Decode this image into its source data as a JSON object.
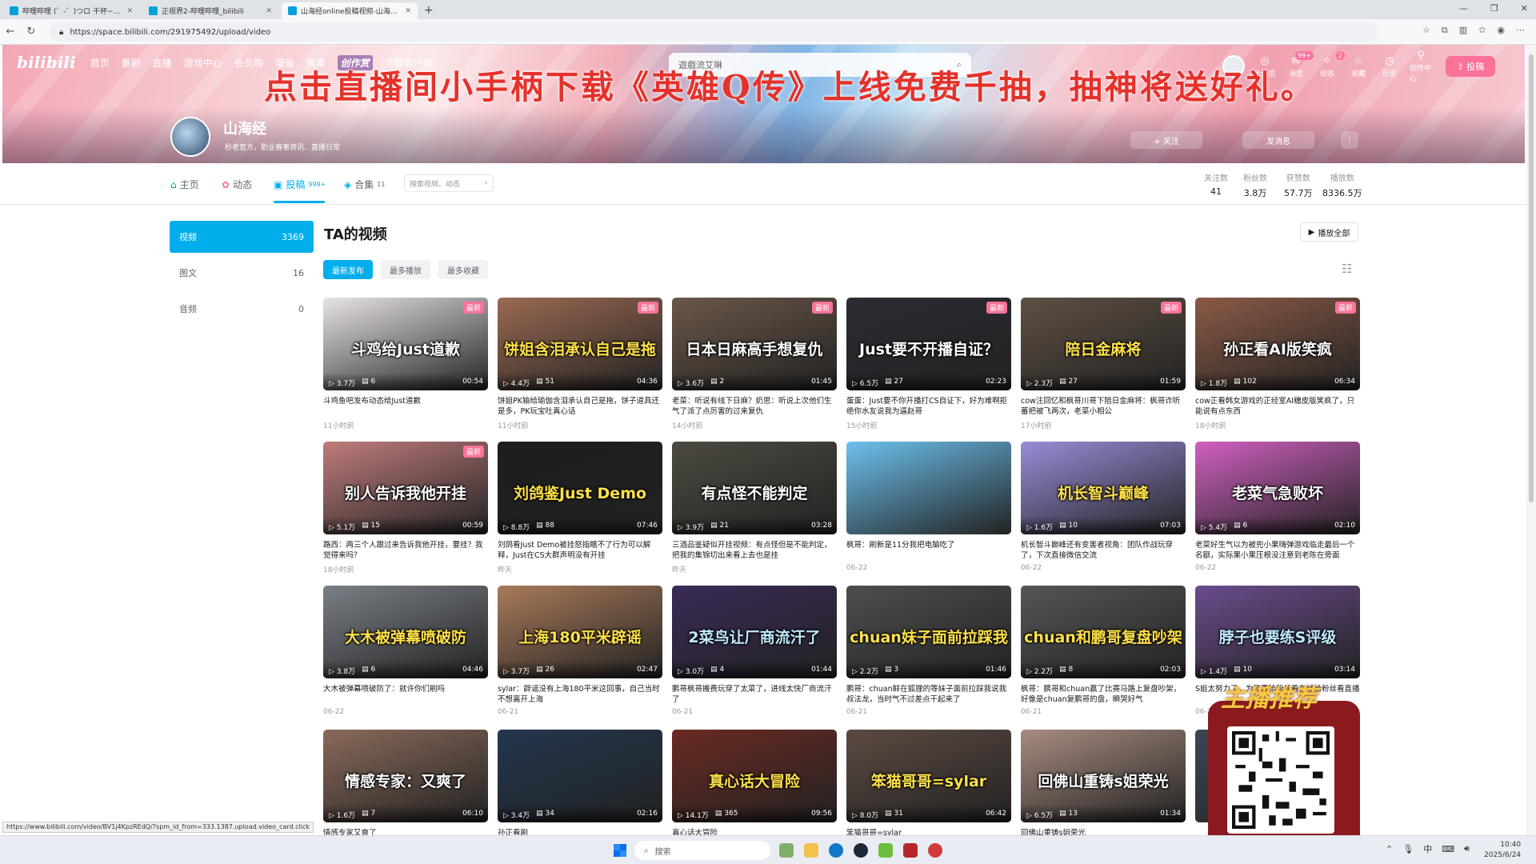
{
  "browser": {
    "tabs": [
      {
        "title": "哔哩哔哩 (゜-゜)つロ 干杯~-bilibili",
        "active": false
      },
      {
        "title": "正视界2-哔哩哔哩_bilibili",
        "active": false
      },
      {
        "title": "山海经online投稿视频-山海经online",
        "active": true
      }
    ],
    "new_tab": "+",
    "url": "https://space.bilibili.com/291975492/upload/video"
  },
  "site": {
    "logo": "bilibili",
    "nav": [
      "首页",
      "番剧",
      "直播",
      "游戏中心",
      "会员购",
      "漫画",
      "赛事",
      "创作赏",
      "下载客户端"
    ],
    "search_placeholder": "遊戲流艾琳",
    "right_nav": [
      {
        "label": "大会员",
        "icon": "vip-icon",
        "badge": ""
      },
      {
        "label": "消息",
        "icon": "message-icon",
        "badge": "99+"
      },
      {
        "label": "动态",
        "icon": "dynamic-icon",
        "badge": "2"
      },
      {
        "label": "收藏",
        "icon": "star-icon",
        "badge": ""
      },
      {
        "label": "历史",
        "icon": "history-icon",
        "badge": ""
      },
      {
        "label": "创作中心",
        "icon": "lightbulb-icon",
        "badge": ""
      }
    ],
    "upload_label": "投稿"
  },
  "overlay": {
    "ad_text": "点击直播间小手柄下载《英雄Q传》上线免费千抽，抽神将送好礼。"
  },
  "profile": {
    "name": "山海经",
    "sign": "秒老官方，职业赛事资讯、直播日常",
    "follow_label": "+ 关注",
    "message_label": "发消息"
  },
  "space_tabs": [
    {
      "label": "主页",
      "count": "",
      "icon": "home-icon"
    },
    {
      "label": "动态",
      "count": "",
      "icon": "dynamic-icon"
    },
    {
      "label": "投稿",
      "count": "999+",
      "icon": "upload-icon"
    },
    {
      "label": "合集",
      "count": "11",
      "icon": "collection-icon"
    }
  ],
  "space_search_placeholder": "搜索视频、动态",
  "stats": [
    {
      "label": "关注数",
      "value": "41"
    },
    {
      "label": "粉丝数",
      "value": "3.8万"
    },
    {
      "label": "获赞数",
      "value": "57.7万"
    },
    {
      "label": "播放数",
      "value": "8336.5万"
    }
  ],
  "sidebar": [
    {
      "label": "视频",
      "count": "3369"
    },
    {
      "label": "图文",
      "count": "16"
    },
    {
      "label": "音频",
      "count": "0"
    }
  ],
  "main": {
    "title": "TA的视频",
    "play_all": "播放全部",
    "sort": [
      "最新发布",
      "最多播放",
      "最多收藏"
    ]
  },
  "videos": [
    {
      "thumb_text": "斗鸡给Just道歉",
      "views": "3.7万",
      "comments": "6",
      "duration": "00:54",
      "title": "斗鸡鱼吧发布动态给Just道歉",
      "date": "11小时前",
      "new": true,
      "bg": "#e9e4e6",
      "tc": ""
    },
    {
      "thumb_text": "饼姐含泪承认自己是拖",
      "views": "4.4万",
      "comments": "51",
      "duration": "04:36",
      "title": "饼姐PK输给瑜伽含泪承认自己是拖，饼子道具还是多，PK玩宝吐真心话",
      "date": "11小时前",
      "new": true,
      "bg": "#9a6a52",
      "tc": "y"
    },
    {
      "thumb_text": "日本日麻高手想复仇",
      "views": "3.6万",
      "comments": "2",
      "duration": "01:45",
      "title": "老菜：听说有线下日麻？奶思：听说上次他们生气了派了点厉害的过来复仇",
      "date": "14小时前",
      "new": true,
      "bg": "#6b5748",
      "tc": ""
    },
    {
      "thumb_text": "Just要不开播自证？",
      "views": "6.5万",
      "comments": "27",
      "duration": "02:23",
      "title": "蛋蛋：Just要不你开播打CS自证下，好为难啊拒绝你水友说我为逼赵哥",
      "date": "15小时前",
      "new": true,
      "bg": "#2a2c33",
      "tc": ""
    },
    {
      "thumb_text": "陪日金麻将",
      "views": "2.3万",
      "comments": "27",
      "duration": "01:59",
      "title": "cow注回忆和枫哥川哥下陪日金麻将：枫哥诈听蕃把被飞两次，老菜小相公",
      "date": "17小时前",
      "new": true,
      "bg": "#5e5044",
      "tc": "y"
    },
    {
      "thumb_text": "孙正看AI版笑疯",
      "views": "1.8万",
      "comments": "102",
      "duration": "06:34",
      "title": "cow正看韩女游戏的正经室AI糖皮版笑疯了，只能说有点东西",
      "date": "18小时前",
      "new": true,
      "bg": "#8a5a46",
      "tc": ""
    },
    {
      "thumb_text": "别人告诉我他开挂",
      "views": "5.1万",
      "comments": "15",
      "duration": "00:59",
      "title": "路西：两三个人跟过来告诉我他开挂，要挂？我觉得来吗？",
      "date": "18小时前",
      "new": true,
      "bg": "#c07c7c",
      "tc": ""
    },
    {
      "thumb_text": "刘鸽鉴Just Demo",
      "views": "8.8万",
      "comments": "88",
      "duration": "07:46",
      "title": "刘鸽看Just Demo被挂怒指瞎不了行为可以解释，Just在CS大群声明没有开挂",
      "date": "昨天",
      "new": false,
      "bg": "#1d1d1f",
      "tc": "y"
    },
    {
      "thumb_text": "有点怪不能判定",
      "views": "3.9万",
      "comments": "21",
      "duration": "03:28",
      "title": "三酒品鉴疑似开挂视频：有点怪但是不能判定，把我的集锦切出来看上去也是挂",
      "date": "昨天",
      "new": false,
      "bg": "#4c4a40",
      "tc": ""
    },
    {
      "thumb_text": "",
      "views": "",
      "comments": "",
      "duration": "",
      "title": "枫哥：刷新是11分我把电脑吃了",
      "date": "06-22",
      "new": false,
      "bg": "#6cc1ee",
      "tc": ""
    },
    {
      "thumb_text": "机长智斗巅峰",
      "views": "1.6万",
      "comments": "10",
      "duration": "07:03",
      "title": "机长智斗巅峰还有变害者视角：团队作战玩穿了，下次直接微信交流",
      "date": "06-22",
      "new": false,
      "bg": "#9a8cd8",
      "tc": "y"
    },
    {
      "thumb_text": "老菜气急败坏",
      "views": "5.4万",
      "comments": "6",
      "duration": "02:10",
      "title": "老菜好生气以为被兜小果嗨弹游戏临走最后一个名额，实际果小果压根没注意到老陈在旁面",
      "date": "06-22",
      "new": false,
      "bg": "#d060c0",
      "tc": ""
    },
    {
      "thumb_text": "大木被弹幕喷破防",
      "views": "3.8万",
      "comments": "6",
      "duration": "04:46",
      "title": "大木被弹幕喷破防了：就许你们刷吗",
      "date": "06-22",
      "new": false,
      "bg": "#7a7f86",
      "tc": "y"
    },
    {
      "thumb_text": "上海180平米辟谣",
      "views": "3.7万",
      "comments": "26",
      "duration": "02:47",
      "title": "sylar：辟谣没有上海180平米这回事，自己当时不想离开上海",
      "date": "06-21",
      "new": false,
      "bg": "#a87a5a",
      "tc": "y"
    },
    {
      "thumb_text": "2菜鸟让厂商流汗了",
      "views": "3.0万",
      "comments": "4",
      "duration": "01:44",
      "title": "鹏哥枫哥搬费玩穿了太菜了，进线太快厂商流汗了",
      "date": "06-21",
      "new": false,
      "bg": "#3a2a56",
      "tc": "lb"
    },
    {
      "thumb_text": "chuan妹子面前拉踩我",
      "views": "2.2万",
      "comments": "3",
      "duration": "01:46",
      "title": "鹏哥：chuan鲜在狐狸的等妹子面前拉踩我说我叔法龙，当时气不过差点干起来了",
      "date": "06-21",
      "new": false,
      "bg": "#4e4e4e",
      "tc": "y"
    },
    {
      "thumb_text": "chuan和鹏哥复盘吵架",
      "views": "2.2万",
      "comments": "8",
      "duration": "02:03",
      "title": "枫哥：鹏哥和chuan赢了比赛马路上复盘吵架，好像是chuan复鹏哥的盘，瞬哭好气",
      "date": "06-21",
      "new": false,
      "bg": "#555555",
      "tc": "y"
    },
    {
      "thumb_text": "脖子也要练S评级",
      "views": "1.4万",
      "comments": "10",
      "duration": "03:14",
      "title": "S姐太努力了，为了弄给粉丝看在线给粉丝看直播",
      "date": "06-21",
      "new": false,
      "bg": "#6a4c8c",
      "tc": "lb"
    },
    {
      "thumb_text": "情感专家：又爽了",
      "views": "1.6万",
      "comments": "7",
      "duration": "06:10",
      "title": "情感专家又爽了",
      "date": "",
      "new": false,
      "bg": "#8a6a5a",
      "tc": ""
    },
    {
      "thumb_text": "",
      "views": "3.4万",
      "comments": "34",
      "duration": "02:16",
      "title": "孙正看剧",
      "date": "",
      "new": false,
      "bg": "#23364e",
      "tc": ""
    },
    {
      "thumb_text": "真心话大冒险",
      "views": "14.1万",
      "comments": "365",
      "duration": "09:56",
      "title": "真心话大冒险",
      "date": "",
      "new": false,
      "bg": "#6a2a22",
      "tc": "y"
    },
    {
      "thumb_text": "笨猫哥哥=sylar",
      "views": "8.0万",
      "comments": "31",
      "duration": "06:42",
      "title": "笨猫哥哥=sylar",
      "date": "",
      "new": false,
      "bg": "#5c4a42",
      "tc": "y"
    },
    {
      "thumb_text": "回佛山重铸s姐荣光",
      "views": "6.5万",
      "comments": "13",
      "duration": "01:34",
      "title": "回佛山重铸s姐荣光",
      "date": "",
      "new": false,
      "bg": "#a88c80",
      "tc": ""
    },
    {
      "thumb_text": "",
      "views": "",
      "comments": "",
      "duration": "",
      "title": "",
      "date": "",
      "new": false,
      "bg": "#3d4656",
      "tc": ""
    }
  ],
  "qr_ad": {
    "tag": "主播推荐"
  },
  "status_url": "https://www.bilibili.com/video/BV1j4KpzREdQ/?spm_id_from=333.1387.upload.video_card.click",
  "taskbar": {
    "search": "搜索",
    "time": "10:40",
    "date": "2025/6/24",
    "ime": "中"
  }
}
